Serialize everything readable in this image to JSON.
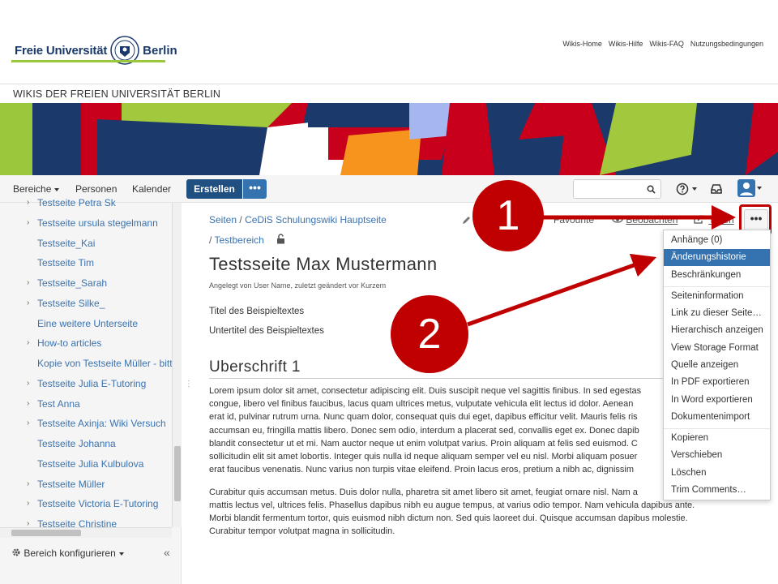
{
  "header": {
    "logo_left": "Freie Universität",
    "logo_right": "Berlin",
    "links": [
      "Wikis-Home",
      "Wikis-Hilfe",
      "Wikis-FAQ",
      "Nutzungsbedingungen"
    ],
    "wiki_title": "WIKIS DER FREIEN UNIVERSITÄT BERLIN"
  },
  "nav": {
    "bereiche": "Bereiche",
    "personen": "Personen",
    "kalender": "Kalender",
    "create": "Erstellen",
    "create_more": "•••",
    "help": "?",
    "search_placeholder": ""
  },
  "sidebar": {
    "items": [
      {
        "label": "Testseite Petra Sk",
        "chevron": true
      },
      {
        "label": "Testseite ursula stegelmann",
        "chevron": true
      },
      {
        "label": "Testseite_Kai",
        "chevron": false
      },
      {
        "label": "Testseite Tim",
        "chevron": false
      },
      {
        "label": "Testseite_Sarah",
        "chevron": true
      },
      {
        "label": "Testseite Silke_",
        "chevron": true
      },
      {
        "label": "Eine weitere Unterseite",
        "chevron": false
      },
      {
        "label": "How-to articles",
        "chevron": true
      },
      {
        "label": "Kopie von Testseite Müller - bitte",
        "chevron": false
      },
      {
        "label": "Testseite Julia E-Tutoring",
        "chevron": true
      },
      {
        "label": "Test Anna",
        "chevron": true
      },
      {
        "label": "Testseite Axinja: Wiki Versuch",
        "chevron": true
      },
      {
        "label": "Testseite Johanna",
        "chevron": false
      },
      {
        "label": "Testseite Julia Kulbulova",
        "chevron": false
      },
      {
        "label": "Testseite Müller",
        "chevron": true
      },
      {
        "label": "Testseite Victoria E-Tutoring",
        "chevron": true
      },
      {
        "label": "Testseite Christine",
        "chevron": true
      }
    ],
    "configure": "Bereich konfigurieren",
    "collapse": "«"
  },
  "breadcrumb": {
    "seiten": "Seiten",
    "sep": "/",
    "space": "CeDiS Schulungswiki Hauptseite",
    "testbereich": "Testbereich"
  },
  "page_actions": {
    "favourite": "Favourite",
    "watch": "Beobachten",
    "share": "Teilen",
    "more": "•••"
  },
  "page": {
    "title": "Testsseite Max Mustermann",
    "byline": "Angelegt von User Name, zuletzt geändert vor Kurzem",
    "line1": "Titel des Beispieltextes",
    "line2": "Untertitel des Beispieltextes",
    "heading1": "Uberschrift 1",
    "para1": [
      "Lorem ipsum dolor sit amet, consectetur adipiscing elit. Duis suscipit neque vel sagittis finibus. In sed egestas",
      "congue, libero vel finibus faucibus, lacus quam ultrices metus, vulputate vehicula elit lectus id dolor. Aenean",
      "erat id, pulvinar rutrum urna. Nunc quam dolor, consequat quis dui eget, dapibus efficitur velit. Mauris felis ris",
      "accumsan eu, fringilla mattis libero. Donec sem odio, interdum a placerat sed, convallis eget ex. Donec dapib",
      "blandit consectetur ut et mi. Nam auctor neque ut enim volutpat varius. Proin aliquam at felis sed euismod. C",
      "sollicitudin elit sit amet lobortis. Integer quis nulla id neque aliquam semper vel eu nisl. Morbi aliquam posuer",
      "erat faucibus venenatis. Nunc varius non turpis vitae eleifend. Proin lacus eros, pretium a nibh ac, dignissim"
    ],
    "para2": [
      "Curabitur quis accumsan metus. Duis dolor nulla, pharetra sit amet libero sit amet, feugiat ornare nisl. Nam a",
      "mattis lectus vel, ultrices felis. Phasellus dapibus nibh eu augue tempus, at varius odio tempor. Nam vehicula dapibus ante.",
      "Morbi blandit fermentum tortor, quis euismod nibh dictum non. Sed quis laoreet dui. Quisque accumsan dapibus molestie.",
      "Curabitur tempor volutpat magna in sollicitudin."
    ]
  },
  "menu": {
    "group1": [
      "Anhänge (0)",
      "Änderungshistorie",
      "Beschränkungen"
    ],
    "group2": [
      "Seiteninformation",
      "Link zu dieser Seite…",
      "Hierarchisch anzeigen",
      "View Storage Format",
      "Quelle anzeigen",
      "In PDF exportieren",
      "In Word exportieren",
      "Dokumentenimport"
    ],
    "group3": [
      "Kopieren",
      "Verschieben",
      "Löschen",
      "Trim Comments…"
    ]
  },
  "annotations": {
    "callout1": "1",
    "callout2": "2",
    "color": "#c00000"
  },
  "colors": {
    "primary": "#205081",
    "link": "#3b73af",
    "menu_active": "#3572b0",
    "fu_green": "#9ac73b"
  }
}
